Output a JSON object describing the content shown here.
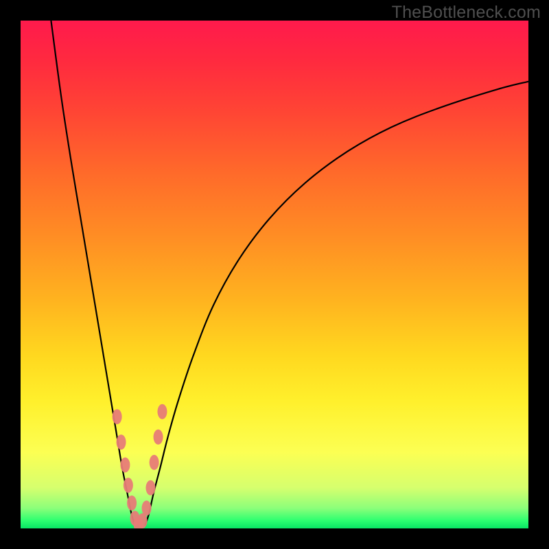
{
  "watermark": "TheBottleneck.com",
  "colors": {
    "curve": "#000000",
    "point": "#e77c77",
    "frame": "#000000"
  },
  "chart_data": {
    "type": "line",
    "title": "",
    "xlabel": "",
    "ylabel": "",
    "xlim": [
      0,
      100
    ],
    "ylim": [
      0,
      100
    ],
    "annotations": [],
    "series": [
      {
        "name": "left-branch",
        "x": [
          6,
          8,
          10,
          12,
          14,
          16,
          17,
          18,
          19,
          20,
          21,
          21.8,
          22.5
        ],
        "y": [
          100,
          85,
          72,
          60,
          48,
          36,
          30,
          24,
          18,
          12,
          7,
          3,
          0.5
        ]
      },
      {
        "name": "right-branch",
        "x": [
          24.5,
          25.3,
          26.2,
          27.5,
          29,
          31,
          34,
          38,
          43,
          49,
          56,
          64,
          73,
          83,
          94,
          100
        ],
        "y": [
          0.5,
          3,
          7,
          12,
          18,
          25,
          34,
          44,
          53,
          61,
          68,
          74,
          79,
          83,
          86.5,
          88
        ]
      }
    ],
    "scatter_points": {
      "name": "highlighted-points",
      "x": [
        19.0,
        19.8,
        20.6,
        21.2,
        21.9,
        22.5,
        23.2,
        24.0,
        24.8,
        25.6,
        26.3,
        27.1,
        27.9
      ],
      "y": [
        22.0,
        17.0,
        12.5,
        8.5,
        5.0,
        2.0,
        0.8,
        1.5,
        4.0,
        8.0,
        13.0,
        18.0,
        23.0
      ]
    }
  }
}
